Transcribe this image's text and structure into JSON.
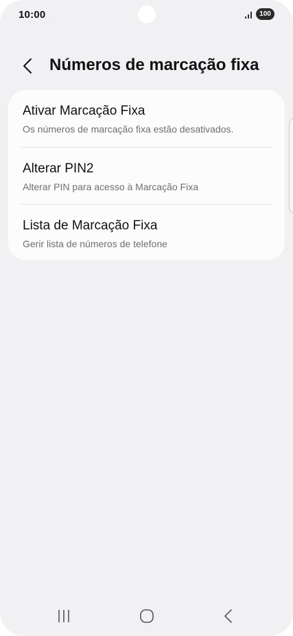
{
  "status_bar": {
    "time": "10:00",
    "battery": "100"
  },
  "header": {
    "title": "Números de marcação fixa"
  },
  "settings": {
    "items": [
      {
        "title": "Ativar Marcação Fixa",
        "subtitle": "Os números de marcação fixa estão desativados."
      },
      {
        "title": "Alterar PIN2",
        "subtitle": "Alterar PIN para acesso à Marcação Fixa"
      },
      {
        "title": "Lista de Marcação Fixa",
        "subtitle": "Gerir lista de números de telefone"
      }
    ]
  },
  "nav_bar": {
    "icons": [
      "recent-apps-icon",
      "home-icon",
      "back-icon"
    ]
  },
  "colors": {
    "background": "#f1f1f4",
    "card": "#fcfcfd",
    "title_text": "#111111",
    "subtitle_text": "#6e6e73",
    "divider": "#e2e2e6"
  }
}
